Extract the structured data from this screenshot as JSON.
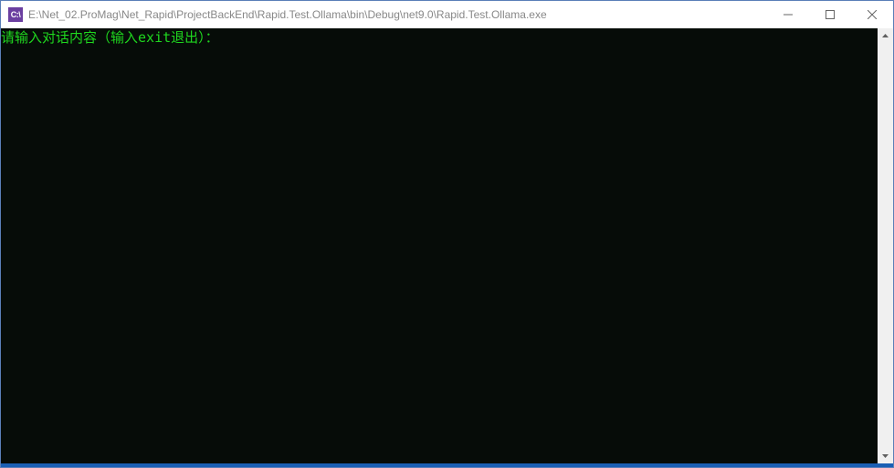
{
  "titlebar": {
    "icon_label": "C:\\",
    "title": "E:\\Net_02.ProMag\\Net_Rapid\\ProjectBackEnd\\Rapid.Test.Ollama\\bin\\Debug\\net9.0\\Rapid.Test.Ollama.exe"
  },
  "console": {
    "prompt_line": "请输入对话内容（输入exit退出）："
  }
}
